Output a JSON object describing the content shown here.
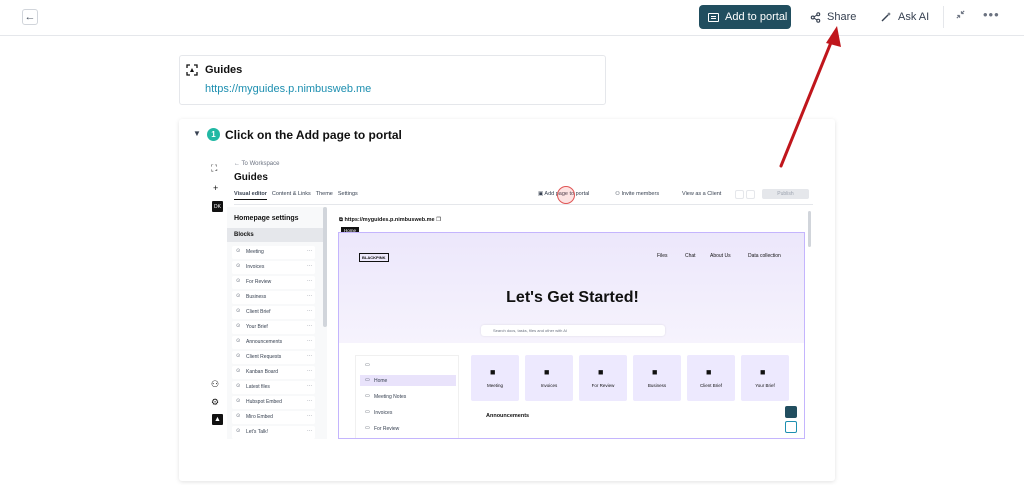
{
  "topbar": {
    "add_to_portal_label": "Add to portal",
    "share_label": "Share",
    "ask_ai_label": "Ask AI",
    "back_icon": "arrow-left-icon",
    "more_icon": "more-horizontal-icon"
  },
  "guide": {
    "title": "Guides",
    "link": "https://myguides.p.nimbusweb.me"
  },
  "step": {
    "number": "1",
    "title": "Click on the Add page to portal"
  },
  "screenshot": {
    "back_link": "← To Workspace",
    "title": "Guides",
    "avatar_initials": "DK",
    "tabs": [
      "Visual editor",
      "Content & Links",
      "Theme",
      "Settings"
    ],
    "actions": {
      "add_page": "Add page to portal",
      "invite": "Invite members",
      "view_as": "View as a Client",
      "publish": "Publish"
    },
    "sidebar": {
      "heading": "Homepage settings",
      "blocks_label": "Blocks",
      "items": [
        "Meeting",
        "Invoices",
        "For Review",
        "Business",
        "Client Brief",
        "Your Brief",
        "Announcements",
        "Client Requests",
        "Kanban Board",
        "Latest files",
        "Hubspot Embed",
        "Miro Embed",
        "Let's Talk!"
      ]
    },
    "url": "https://myguides.p.nimbusweb.me",
    "home_tag": "Home",
    "site": {
      "logo": "BLACKPINK",
      "nav": [
        "Files",
        "Chat",
        "About Us",
        "Data collection"
      ],
      "hero_title": "Let's Get Started!",
      "search_placeholder": "Search docs, tasks, files and other with AI",
      "menu": [
        "Home",
        "Meeting Notes",
        "Invoices",
        "For Review"
      ],
      "tiles": [
        "Meeting",
        "Invoices",
        "For Review",
        "Business",
        "Client Brief",
        "Your Brief"
      ],
      "announcements": "Announcements"
    }
  },
  "colors": {
    "primary": "#214e5f",
    "link": "#1d8fb0",
    "step_badge": "#22b8a4",
    "arrow": "#c0161c"
  }
}
